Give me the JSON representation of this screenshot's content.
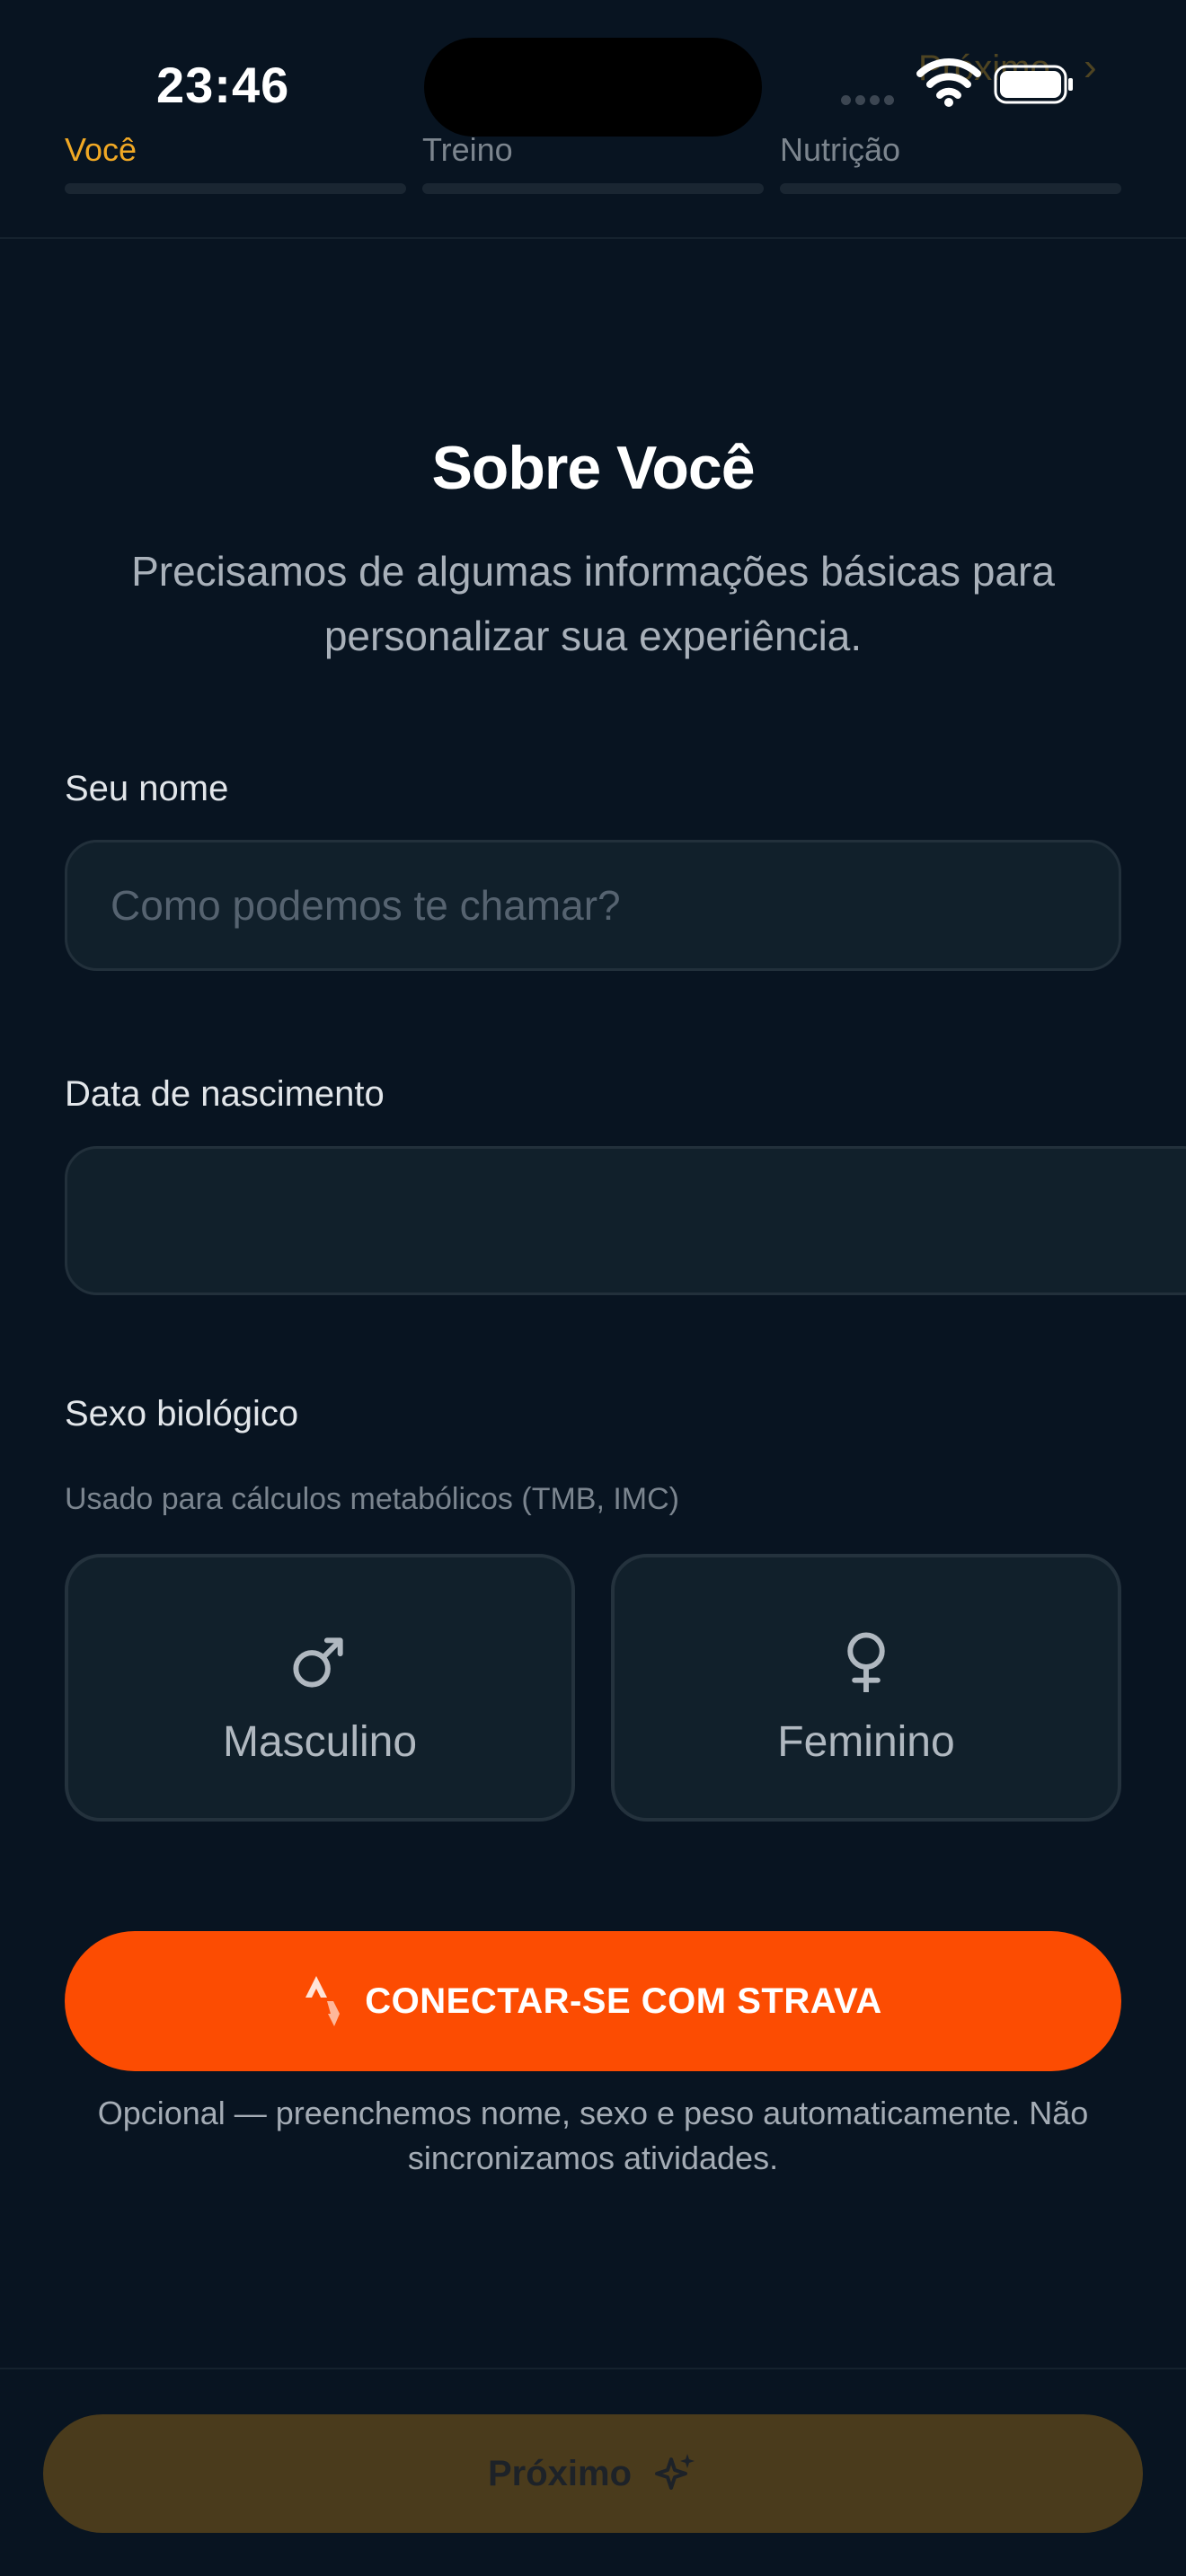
{
  "status_bar": {
    "time": "23:46"
  },
  "header": {
    "next_label": "Próximo"
  },
  "steps": [
    {
      "label": "Você",
      "active": true,
      "color": "#f0a824"
    },
    {
      "label": "Treino",
      "active": false,
      "color": "#7c858e"
    },
    {
      "label": "Nutrição",
      "active": false,
      "color": "#7c858e"
    }
  ],
  "page": {
    "title": "Sobre Você",
    "subtitle": "Precisamos de algumas informações básicas para personalizar sua experiência."
  },
  "form": {
    "name": {
      "label": "Seu nome",
      "placeholder": "Como podemos te chamar?",
      "value": ""
    },
    "birthdate": {
      "label": "Data de nascimento",
      "value": ""
    },
    "sex": {
      "label": "Sexo biológico",
      "hint": "Usado para cálculos metabólicos (TMB, IMC)",
      "options": [
        {
          "label": "Masculino",
          "icon": "male-symbol-icon"
        },
        {
          "label": "Feminino",
          "icon": "female-symbol-icon"
        }
      ]
    }
  },
  "strava": {
    "button_label": "CONECTAR-SE COM STRAVA",
    "note": "Opcional — preenchemos nome, sexo e peso automaticamente. Não sincronizamos atividades.",
    "color": "#fc4c02"
  },
  "footer": {
    "next_label": "Próximo",
    "icon": "sparkles-icon",
    "color": "#4a3b1c"
  }
}
